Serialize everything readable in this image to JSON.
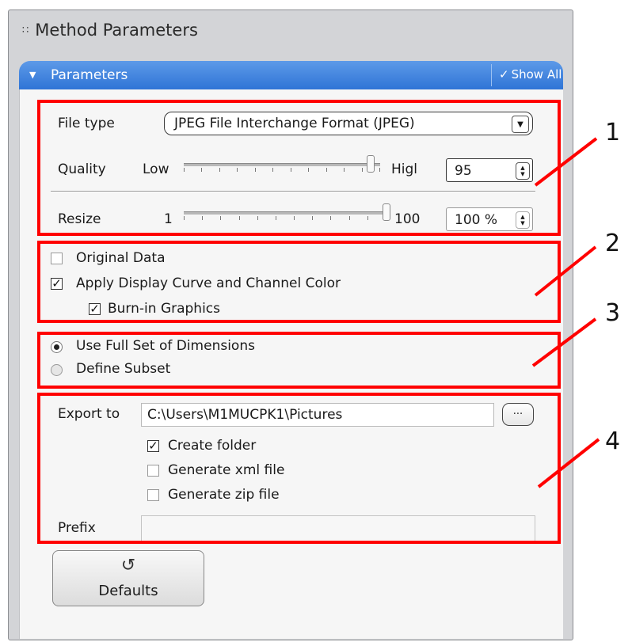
{
  "panel": {
    "title": "Method Parameters",
    "grip_icon": "grip-icon"
  },
  "header": {
    "title": "Parameters",
    "show_all": "Show All",
    "check": "✓"
  },
  "file_type": {
    "label": "File type",
    "value": "JPEG File Interchange Format (JPEG)"
  },
  "quality": {
    "label": "Quality",
    "low": "Low",
    "high": "Higl",
    "value": "95",
    "slider_level": 0.95
  },
  "resize": {
    "label": "Resize",
    "min": "1",
    "max": "100",
    "value": "100 %",
    "slider_level": 1.0
  },
  "data_options": {
    "original_data": {
      "label": "Original Data",
      "checked": false
    },
    "apply_display": {
      "label": "Apply Display Curve and Channel Color",
      "checked": true
    },
    "burn_in": {
      "label": "Burn-in Graphics",
      "checked": true
    }
  },
  "dimensions": {
    "full_set": {
      "label": "Use Full Set of Dimensions",
      "selected": true
    },
    "subset": {
      "label": "Define Subset",
      "selected": false
    }
  },
  "export": {
    "label": "Export to",
    "path": "C:\\Users\\M1MUCPK1\\Pictures",
    "browse": "...",
    "create_folder": {
      "label": "Create folder",
      "checked": true
    },
    "xml_file": {
      "label": "Generate xml file",
      "checked": false
    },
    "zip_file": {
      "label": "Generate zip file",
      "checked": false
    },
    "prefix_label": "Prefix",
    "prefix_value": ""
  },
  "defaults_button": {
    "label": "Defaults",
    "icon": "undo-icon"
  },
  "callouts": [
    "1",
    "2",
    "3",
    "4"
  ],
  "colors": {
    "accent": "#2f74d6",
    "highlight": "#ff0000"
  }
}
